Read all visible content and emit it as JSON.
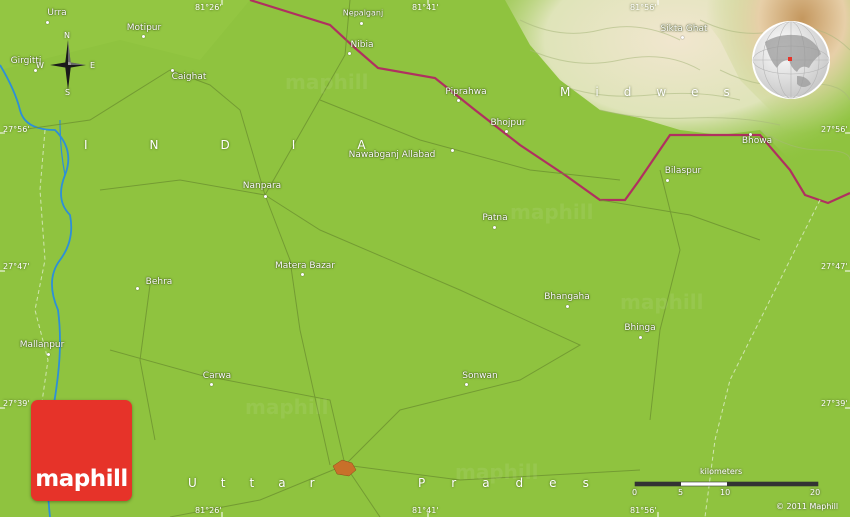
{
  "map": {
    "brand": "maphill",
    "copyright": "© 2011 Maphill",
    "colors": {
      "land": "#8fc33f",
      "river": "#2d8fd8",
      "border": "#b03060",
      "relief": "#e8d2b0",
      "logo": "#e63329",
      "city": "#c8702a"
    },
    "compass": {
      "n": "N",
      "s": "S",
      "e": "E",
      "w": "W"
    },
    "scale": {
      "title": "kilometers",
      "ticks": [
        "0",
        "5",
        "10",
        "20"
      ]
    },
    "coords_top": [
      "81°26'",
      "81°41'",
      "81°56'"
    ],
    "coords_bottom": [
      "81°26'",
      "81°41'",
      "81°56'"
    ],
    "coords_left": [
      "27°56'",
      "27°47'",
      "27°39'"
    ],
    "coords_right": [
      "27°56'",
      "27°47'",
      "27°39'"
    ],
    "regions": {
      "india": [
        "I",
        "N",
        "D",
        "I",
        "A"
      ],
      "midwest": [
        "M",
        "i",
        "d",
        "w",
        "e",
        "s"
      ],
      "uttar": [
        "U",
        "t",
        "t",
        "a",
        "r"
      ],
      "pradesh": [
        "P",
        "r",
        "a",
        "d",
        "e",
        "s"
      ]
    },
    "places": [
      {
        "id": "urra",
        "name": "Urra"
      },
      {
        "id": "motipur",
        "name": "Motipur"
      },
      {
        "id": "nepalganj",
        "name": "Nepalganj"
      },
      {
        "id": "nibia",
        "name": "Nibia"
      },
      {
        "id": "girgitti",
        "name": "Girgitti"
      },
      {
        "id": "caighat",
        "name": "Caighat"
      },
      {
        "id": "piprahwa",
        "name": "Piprahwa"
      },
      {
        "id": "bhojpur",
        "name": "Bhojpur"
      },
      {
        "id": "siktaghat",
        "name": "Sikta Ghat"
      },
      {
        "id": "bhowa",
        "name": "Bhowa"
      },
      {
        "id": "nawabganj",
        "name": "Nawabganj Allabad"
      },
      {
        "id": "nanpara",
        "name": "Nanpara"
      },
      {
        "id": "bilaspur",
        "name": "Bilaspur"
      },
      {
        "id": "patna",
        "name": "Patna"
      },
      {
        "id": "materabazar",
        "name": "Matera Bazar"
      },
      {
        "id": "behra",
        "name": "Behra"
      },
      {
        "id": "bhangaha",
        "name": "Bhangaha"
      },
      {
        "id": "bhinga",
        "name": "Bhinga"
      },
      {
        "id": "mallanpur",
        "name": "Mallanpur"
      },
      {
        "id": "carwa",
        "name": "Carwa"
      },
      {
        "id": "sonwan",
        "name": "Sonwan"
      }
    ]
  }
}
